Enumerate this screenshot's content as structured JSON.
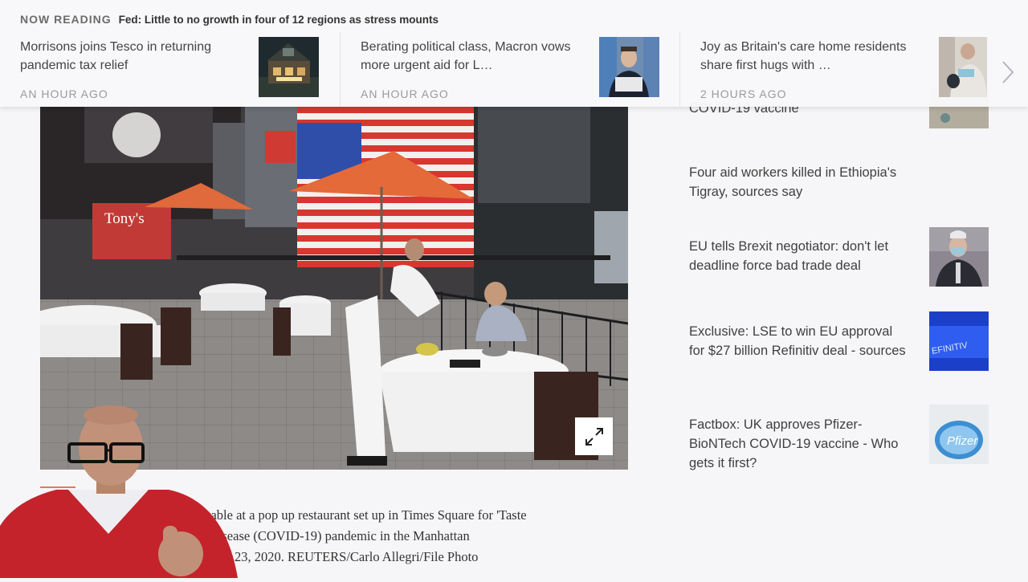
{
  "ribbon": {
    "now_reading_label": "NOW READING",
    "now_reading_title": "Fed: Little to no growth in four of 12 regions as stress mounts",
    "cards": [
      {
        "headline": "Morrisons joins Tesco in returning pandemic tax relief",
        "time": "AN HOUR AGO"
      },
      {
        "headline": "Berating political class, Macron vows more urgent aid for L…",
        "time": "AN HOUR AGO"
      },
      {
        "headline": "Joy as Britain's care home residents share first hugs with …",
        "time": "2 HOURS AGO"
      }
    ],
    "next_icon": "chevron-right-icon"
  },
  "article": {
    "caption_lines": [
      "P                       ckage food at a table at a pop up restaurant set up in Times Square for 'Taste",
      "                          the coronavirus disease (COVID-19) pandemic in the Manhattan",
      "                          York, U.S., October 23, 2020. REUTERS/Carlo Allegri/File Photo"
    ],
    "expand_icon": "expand-icon",
    "accent_color": "#e47a55"
  },
  "rail": {
    "items": [
      {
        "headline": "COVID-19 vaccine"
      },
      {
        "headline": "Four aid workers killed in Ethiopia's Tigray, sources say"
      },
      {
        "headline": "EU tells Brexit negotiator: don't let deadline force bad trade deal"
      },
      {
        "headline": "Exclusive: LSE to win EU approval for $27 billion Refinitiv deal - sources"
      },
      {
        "headline": "Factbox: UK approves Pfizer-BioNTech COVID-19 vaccine - Who gets it first?"
      }
    ]
  }
}
